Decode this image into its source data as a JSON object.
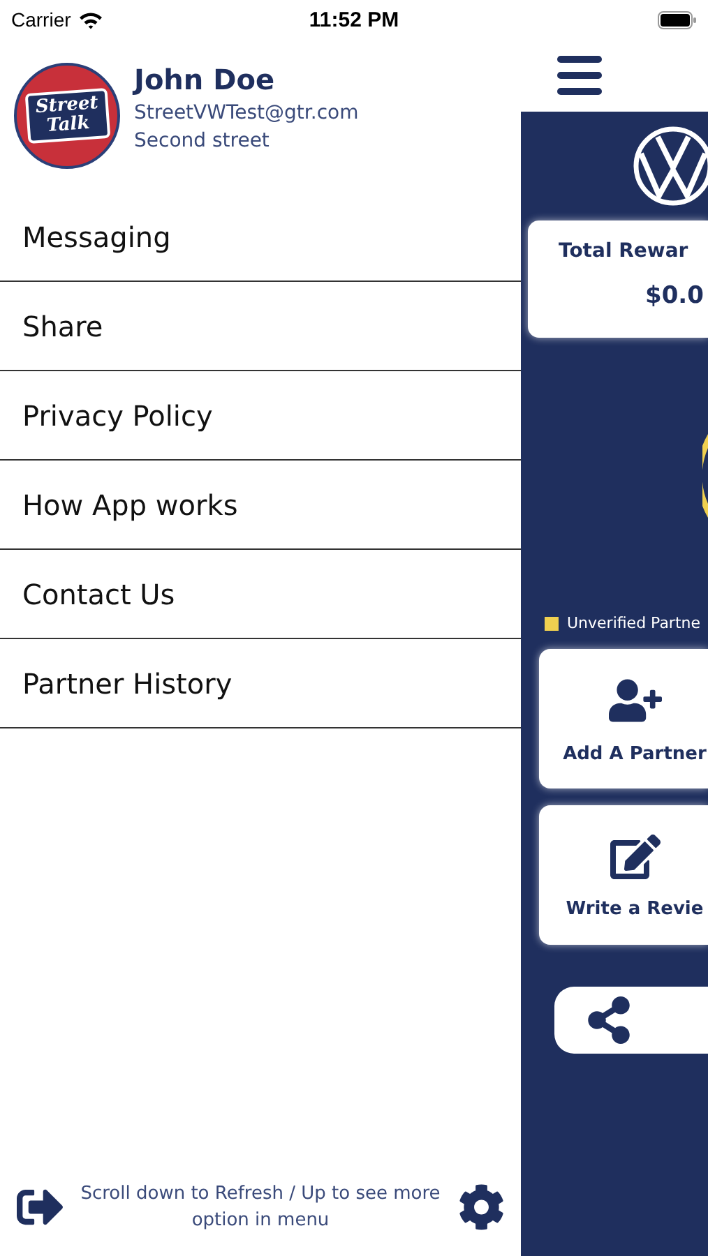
{
  "status_bar": {
    "carrier": "Carrier",
    "time": "11:52 PM"
  },
  "profile": {
    "logo_lines": [
      "Street",
      "Talk"
    ],
    "name": "John Doe",
    "email": "StreetVWTest@gtr.com",
    "address": "Second street"
  },
  "menu": [
    {
      "label": "Messaging"
    },
    {
      "label": "Share"
    },
    {
      "label": "Privacy Policy"
    },
    {
      "label": "How App works"
    },
    {
      "label": "Contact Us"
    },
    {
      "label": "Partner History"
    }
  ],
  "footer": {
    "hint": "Scroll down to Refresh / Up to see more option in menu"
  },
  "main": {
    "rewards": {
      "title": "Total Rewar",
      "amount": "$0.0"
    },
    "legend": [
      {
        "label": "Unverified Partne",
        "color": "#f0d050"
      }
    ],
    "actions": [
      {
        "kind": "add-partner",
        "label": "Add A Partner"
      },
      {
        "kind": "review",
        "label": "Write a Revie"
      }
    ]
  }
}
